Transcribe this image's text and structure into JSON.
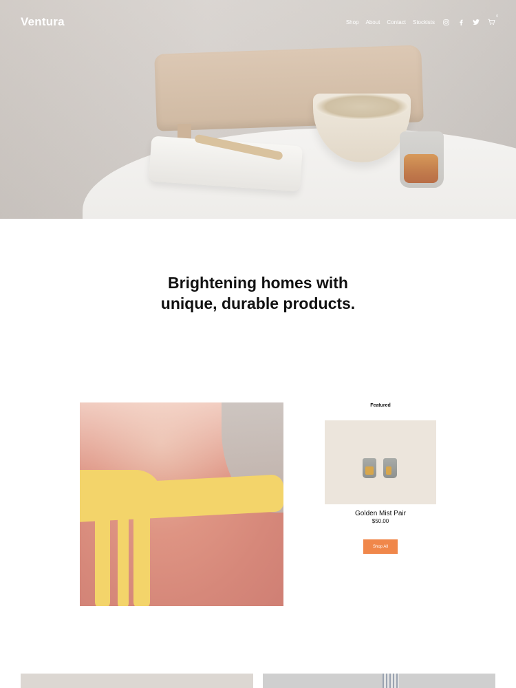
{
  "brand": {
    "name": "Ventura"
  },
  "nav": {
    "links": [
      {
        "label": "Shop"
      },
      {
        "label": "About"
      },
      {
        "label": "Contact"
      },
      {
        "label": "Stockists"
      }
    ],
    "icons": [
      "instagram-icon",
      "facebook-icon",
      "twitter-icon",
      "cart-icon"
    ],
    "cart_count": "0"
  },
  "hero": {
    "image": "hero-photo"
  },
  "tagline": {
    "line1": "Brightening homes with",
    "line2": "unique, durable products."
  },
  "featured": {
    "label": "Featured",
    "product": {
      "name": "Golden Mist Pair",
      "price": "$50.00"
    },
    "shop_all_label": "Shop All"
  },
  "colors": {
    "accent": "#f0874a",
    "text": "#111111",
    "card_bg": "#ece5dc"
  }
}
